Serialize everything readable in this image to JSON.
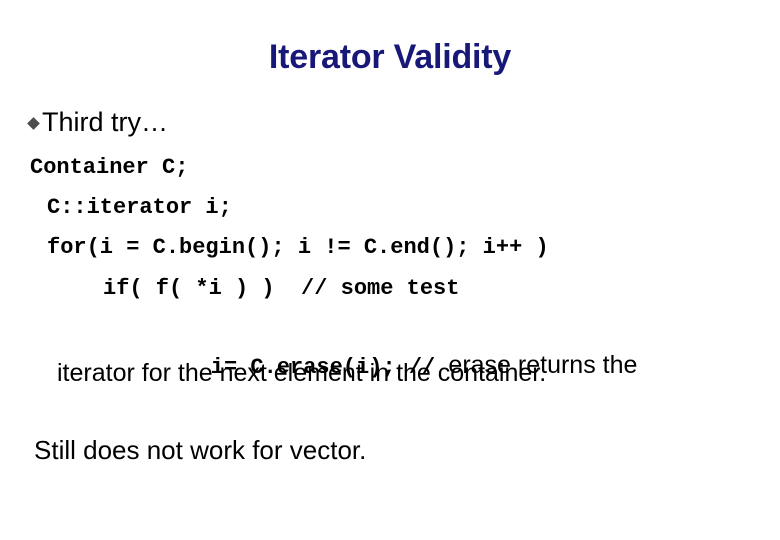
{
  "slide": {
    "title": "Iterator Validity",
    "title_color": "#181878",
    "background_color": "#ffffff",
    "text_color": "#000000",
    "bullet": {
      "icon": "diamond-bullet-icon",
      "icon_color": "#4d4d4d",
      "label": "Third try…"
    },
    "code": {
      "line1": "Container C;",
      "line2": "C::iterator i;",
      "line3": "for(i = C.begin(); i != C.end(); i++ )",
      "line4": "if( f( *i ) )  // some test",
      "line5_code": "i= C.erase(i); // ",
      "line5_prose": "erase returns the",
      "line6_prose": "iterator for the next element in the container."
    },
    "closing_note": "Still does not work for vector."
  }
}
